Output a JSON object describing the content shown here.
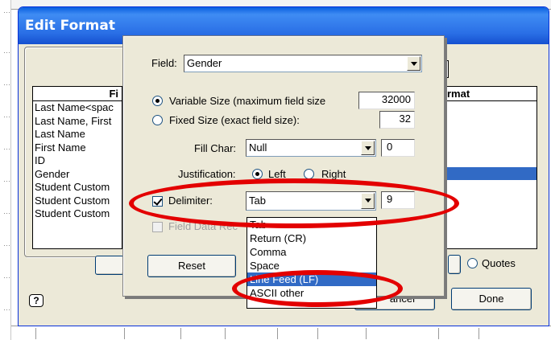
{
  "dialog": {
    "title": "Edit Format"
  },
  "fields_list": {
    "header": "Fi",
    "rows": [
      "Last Name<spac",
      "Last Name, First",
      "Last Name",
      "First Name",
      "ID",
      "Gender",
      "Student Custom",
      "Student Custom",
      "Student Custom"
    ]
  },
  "format_list": {
    "header": "rmat"
  },
  "outer_buttons": {
    "done": "Done",
    "one_partial": "one",
    "cancel_partial": "ancel",
    "quotes": "Quotes"
  },
  "inner": {
    "field_label": "Field:",
    "field_value": "Gender",
    "variable_size_label": "Variable Size (maximum field size",
    "variable_size_value": "32000",
    "fixed_size_label": "Fixed Size (exact field size):",
    "fixed_size_value": "32",
    "fill_char_label": "Fill Char:",
    "fill_char_value": "Null",
    "fill_char_code": "0",
    "justification_label": "Justification:",
    "left_label": "Left",
    "right_label": "Right",
    "delimiter_label": "Delimiter:",
    "delimiter_value": "Tab",
    "delimiter_code": "9",
    "field_data_label": "Field Data Rec",
    "reset_label": "Reset"
  },
  "dropdown": {
    "items": [
      "Tab",
      "Return (CR)",
      "Comma",
      "Space",
      "Line Feed (LF)",
      "ASCII other"
    ],
    "selected": "Line Feed (LF)"
  },
  "colors": {
    "highlight": "#316ac5",
    "annotation": "#e30000",
    "titlebar": "#2a6fe6"
  }
}
